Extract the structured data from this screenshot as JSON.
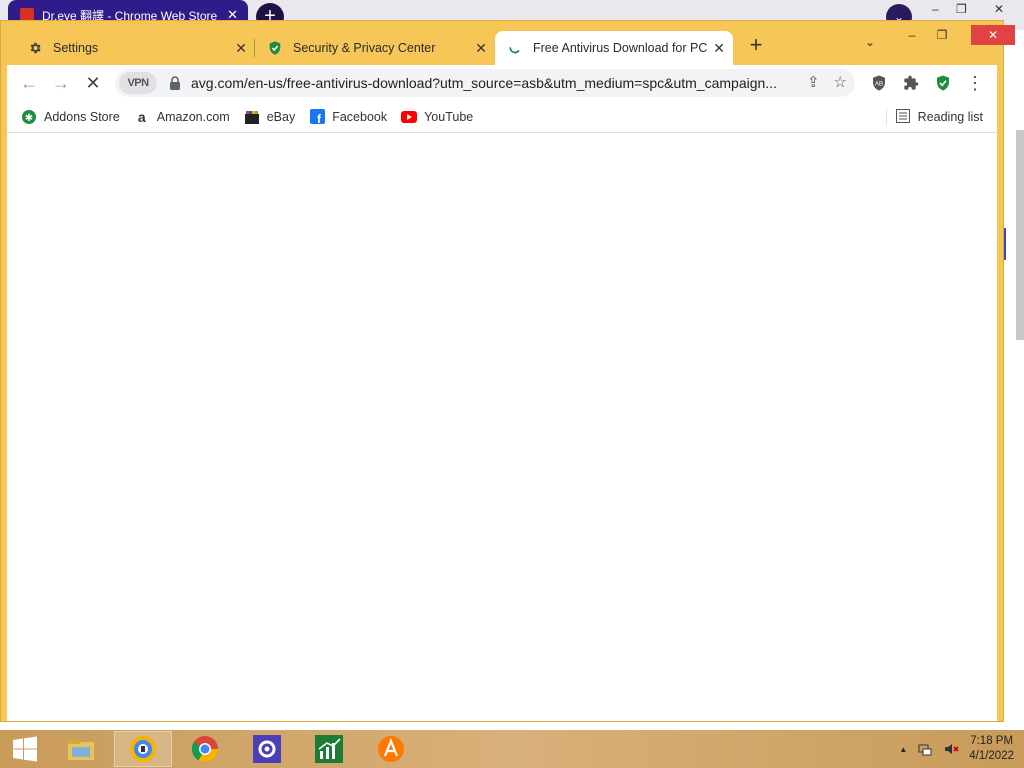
{
  "background_window": {
    "tab_title": "Dr.eye 翻譯 - Chrome Web Store",
    "tab_close": "✕",
    "newtab": "+",
    "profile": "⌄",
    "controls": [
      "–",
      "❐",
      "✕"
    ]
  },
  "tabs": [
    {
      "title": "Settings",
      "icon": "gear-icon",
      "active": false
    },
    {
      "title": "Security & Privacy Center",
      "icon": "shield-check-icon",
      "active": false
    },
    {
      "title": "Free Antivirus Download for PC |",
      "icon": "loading-spinner-icon",
      "active": true
    }
  ],
  "tab_close_glyph": "✕",
  "newtab_glyph": "+",
  "tabsearch_glyph": "⌄",
  "window_controls": [
    "–",
    "❐",
    "✕"
  ],
  "toolbar": {
    "back": "←",
    "forward": "→",
    "stop": "✕",
    "vpn_label": "VPN",
    "url": "avg.com/en-us/free-antivirus-download?utm_source=asb&utm_medium=spc&utm_campaign...",
    "share": "⇪",
    "star": "☆",
    "menu": "⋮"
  },
  "bookmarks": [
    {
      "label": "Addons Store",
      "icon": "addons-store-icon"
    },
    {
      "label": "Amazon.com",
      "icon": "amazon-icon"
    },
    {
      "label": "eBay",
      "icon": "ebay-icon"
    },
    {
      "label": "Facebook",
      "icon": "facebook-icon"
    },
    {
      "label": "YouTube",
      "icon": "youtube-icon"
    }
  ],
  "reading_list": "Reading list",
  "taskbar": {
    "time": "7:18 PM",
    "date": "4/1/2022",
    "tray_up": "▲"
  },
  "colors": {
    "frame": "#f6c657",
    "shield_green": "#1e8e3e",
    "spinner": "#1a73e8"
  }
}
